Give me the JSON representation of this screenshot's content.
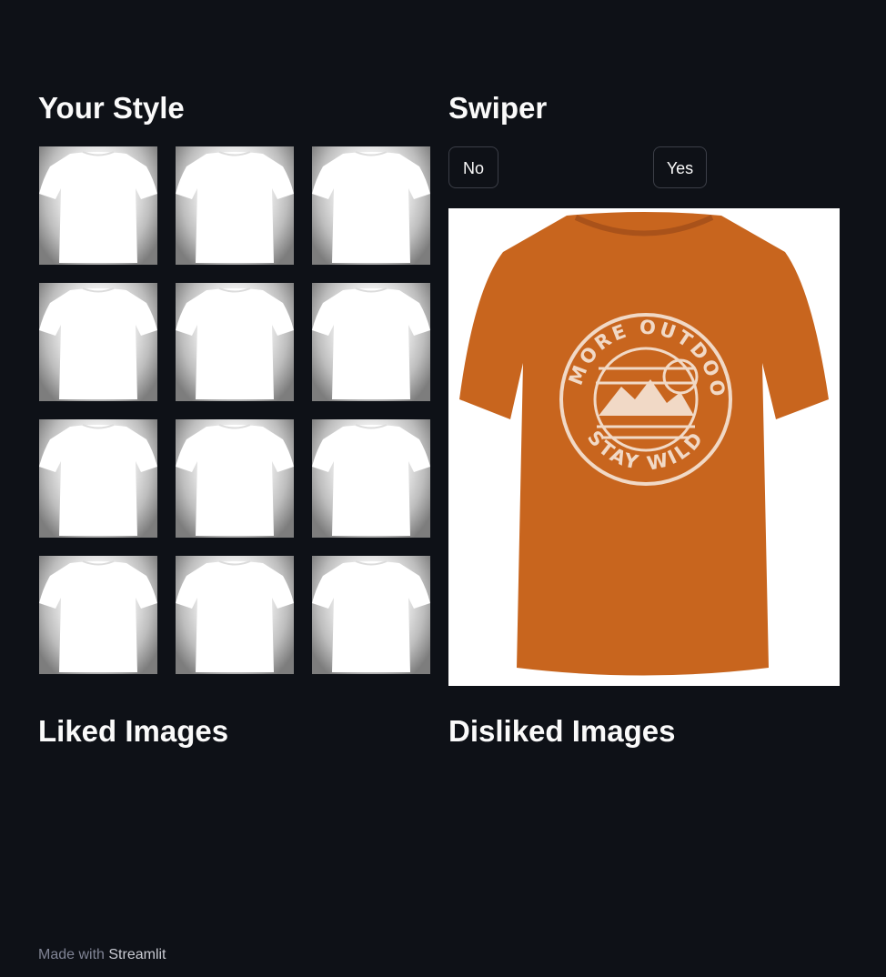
{
  "sections": {
    "your_style": "Your Style",
    "swiper": "Swiper",
    "liked": "Liked Images",
    "disliked": "Disliked Images"
  },
  "buttons": {
    "no": "No",
    "yes": "Yes"
  },
  "style_grid": {
    "count": 12,
    "item": "white-tshirt-image"
  },
  "current_item": {
    "shirt_color": "#c8651e",
    "print_color": "#f1d9c6",
    "print_top_text": "DO MORE OUTDOORS",
    "print_bottom_text": "STAY WILD"
  },
  "footer": {
    "prefix": "Made with ",
    "link": "Streamlit"
  },
  "colors": {
    "background": "#0e1117",
    "text": "#fafafa",
    "muted": "#808495"
  }
}
